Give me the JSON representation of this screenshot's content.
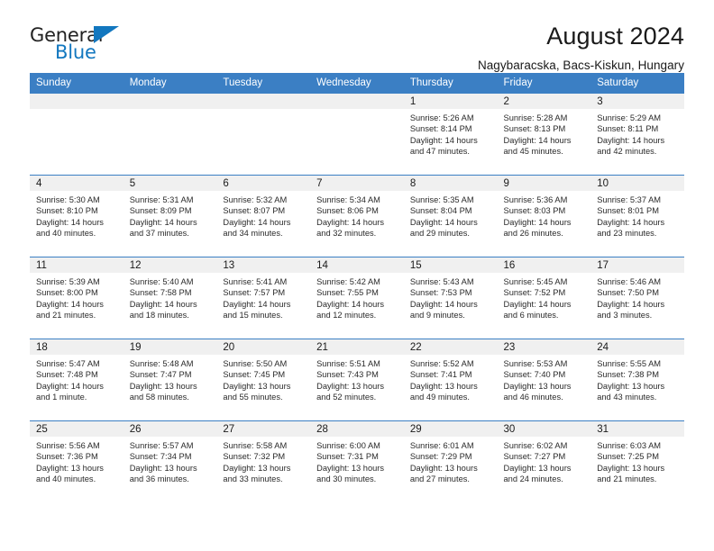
{
  "logo": {
    "word_top": "General",
    "word_bottom": "Blue",
    "triangle_color": "#1277bf",
    "text_color": "#222222"
  },
  "header": {
    "title": "August 2024",
    "subtitle": "Nagybaracska, Bacs-Kiskun, Hungary"
  },
  "colors": {
    "header_bg": "#3b7fc4",
    "daynum_bg": "#f0f0f0",
    "row_border": "#3b7fc4",
    "brand_blue": "#1277bf"
  },
  "calendar": {
    "weekday_headers": [
      "Sunday",
      "Monday",
      "Tuesday",
      "Wednesday",
      "Thursday",
      "Friday",
      "Saturday"
    ],
    "labels": {
      "sunrise": "Sunrise:",
      "sunset": "Sunset:",
      "daylight": "Daylight:"
    },
    "weeks": [
      [
        {
          "day": "",
          "sunrise": "",
          "sunset": "",
          "daylight": "",
          "blank": true
        },
        {
          "day": "",
          "sunrise": "",
          "sunset": "",
          "daylight": "",
          "blank": true
        },
        {
          "day": "",
          "sunrise": "",
          "sunset": "",
          "daylight": "",
          "blank": true
        },
        {
          "day": "",
          "sunrise": "",
          "sunset": "",
          "daylight": "",
          "blank": true
        },
        {
          "day": "1",
          "sunrise": "Sunrise: 5:26 AM",
          "sunset": "Sunset: 8:14 PM",
          "daylight": "Daylight: 14 hours and 47 minutes.",
          "blank": false
        },
        {
          "day": "2",
          "sunrise": "Sunrise: 5:28 AM",
          "sunset": "Sunset: 8:13 PM",
          "daylight": "Daylight: 14 hours and 45 minutes.",
          "blank": false
        },
        {
          "day": "3",
          "sunrise": "Sunrise: 5:29 AM",
          "sunset": "Sunset: 8:11 PM",
          "daylight": "Daylight: 14 hours and 42 minutes.",
          "blank": false
        }
      ],
      [
        {
          "day": "4",
          "sunrise": "Sunrise: 5:30 AM",
          "sunset": "Sunset: 8:10 PM",
          "daylight": "Daylight: 14 hours and 40 minutes.",
          "blank": false
        },
        {
          "day": "5",
          "sunrise": "Sunrise: 5:31 AM",
          "sunset": "Sunset: 8:09 PM",
          "daylight": "Daylight: 14 hours and 37 minutes.",
          "blank": false
        },
        {
          "day": "6",
          "sunrise": "Sunrise: 5:32 AM",
          "sunset": "Sunset: 8:07 PM",
          "daylight": "Daylight: 14 hours and 34 minutes.",
          "blank": false
        },
        {
          "day": "7",
          "sunrise": "Sunrise: 5:34 AM",
          "sunset": "Sunset: 8:06 PM",
          "daylight": "Daylight: 14 hours and 32 minutes.",
          "blank": false
        },
        {
          "day": "8",
          "sunrise": "Sunrise: 5:35 AM",
          "sunset": "Sunset: 8:04 PM",
          "daylight": "Daylight: 14 hours and 29 minutes.",
          "blank": false
        },
        {
          "day": "9",
          "sunrise": "Sunrise: 5:36 AM",
          "sunset": "Sunset: 8:03 PM",
          "daylight": "Daylight: 14 hours and 26 minutes.",
          "blank": false
        },
        {
          "day": "10",
          "sunrise": "Sunrise: 5:37 AM",
          "sunset": "Sunset: 8:01 PM",
          "daylight": "Daylight: 14 hours and 23 minutes.",
          "blank": false
        }
      ],
      [
        {
          "day": "11",
          "sunrise": "Sunrise: 5:39 AM",
          "sunset": "Sunset: 8:00 PM",
          "daylight": "Daylight: 14 hours and 21 minutes.",
          "blank": false
        },
        {
          "day": "12",
          "sunrise": "Sunrise: 5:40 AM",
          "sunset": "Sunset: 7:58 PM",
          "daylight": "Daylight: 14 hours and 18 minutes.",
          "blank": false
        },
        {
          "day": "13",
          "sunrise": "Sunrise: 5:41 AM",
          "sunset": "Sunset: 7:57 PM",
          "daylight": "Daylight: 14 hours and 15 minutes.",
          "blank": false
        },
        {
          "day": "14",
          "sunrise": "Sunrise: 5:42 AM",
          "sunset": "Sunset: 7:55 PM",
          "daylight": "Daylight: 14 hours and 12 minutes.",
          "blank": false
        },
        {
          "day": "15",
          "sunrise": "Sunrise: 5:43 AM",
          "sunset": "Sunset: 7:53 PM",
          "daylight": "Daylight: 14 hours and 9 minutes.",
          "blank": false
        },
        {
          "day": "16",
          "sunrise": "Sunrise: 5:45 AM",
          "sunset": "Sunset: 7:52 PM",
          "daylight": "Daylight: 14 hours and 6 minutes.",
          "blank": false
        },
        {
          "day": "17",
          "sunrise": "Sunrise: 5:46 AM",
          "sunset": "Sunset: 7:50 PM",
          "daylight": "Daylight: 14 hours and 3 minutes.",
          "blank": false
        }
      ],
      [
        {
          "day": "18",
          "sunrise": "Sunrise: 5:47 AM",
          "sunset": "Sunset: 7:48 PM",
          "daylight": "Daylight: 14 hours and 1 minute.",
          "blank": false
        },
        {
          "day": "19",
          "sunrise": "Sunrise: 5:48 AM",
          "sunset": "Sunset: 7:47 PM",
          "daylight": "Daylight: 13 hours and 58 minutes.",
          "blank": false
        },
        {
          "day": "20",
          "sunrise": "Sunrise: 5:50 AM",
          "sunset": "Sunset: 7:45 PM",
          "daylight": "Daylight: 13 hours and 55 minutes.",
          "blank": false
        },
        {
          "day": "21",
          "sunrise": "Sunrise: 5:51 AM",
          "sunset": "Sunset: 7:43 PM",
          "daylight": "Daylight: 13 hours and 52 minutes.",
          "blank": false
        },
        {
          "day": "22",
          "sunrise": "Sunrise: 5:52 AM",
          "sunset": "Sunset: 7:41 PM",
          "daylight": "Daylight: 13 hours and 49 minutes.",
          "blank": false
        },
        {
          "day": "23",
          "sunrise": "Sunrise: 5:53 AM",
          "sunset": "Sunset: 7:40 PM",
          "daylight": "Daylight: 13 hours and 46 minutes.",
          "blank": false
        },
        {
          "day": "24",
          "sunrise": "Sunrise: 5:55 AM",
          "sunset": "Sunset: 7:38 PM",
          "daylight": "Daylight: 13 hours and 43 minutes.",
          "blank": false
        }
      ],
      [
        {
          "day": "25",
          "sunrise": "Sunrise: 5:56 AM",
          "sunset": "Sunset: 7:36 PM",
          "daylight": "Daylight: 13 hours and 40 minutes.",
          "blank": false
        },
        {
          "day": "26",
          "sunrise": "Sunrise: 5:57 AM",
          "sunset": "Sunset: 7:34 PM",
          "daylight": "Daylight: 13 hours and 36 minutes.",
          "blank": false
        },
        {
          "day": "27",
          "sunrise": "Sunrise: 5:58 AM",
          "sunset": "Sunset: 7:32 PM",
          "daylight": "Daylight: 13 hours and 33 minutes.",
          "blank": false
        },
        {
          "day": "28",
          "sunrise": "Sunrise: 6:00 AM",
          "sunset": "Sunset: 7:31 PM",
          "daylight": "Daylight: 13 hours and 30 minutes.",
          "blank": false
        },
        {
          "day": "29",
          "sunrise": "Sunrise: 6:01 AM",
          "sunset": "Sunset: 7:29 PM",
          "daylight": "Daylight: 13 hours and 27 minutes.",
          "blank": false
        },
        {
          "day": "30",
          "sunrise": "Sunrise: 6:02 AM",
          "sunset": "Sunset: 7:27 PM",
          "daylight": "Daylight: 13 hours and 24 minutes.",
          "blank": false
        },
        {
          "day": "31",
          "sunrise": "Sunrise: 6:03 AM",
          "sunset": "Sunset: 7:25 PM",
          "daylight": "Daylight: 13 hours and 21 minutes.",
          "blank": false
        }
      ]
    ]
  }
}
